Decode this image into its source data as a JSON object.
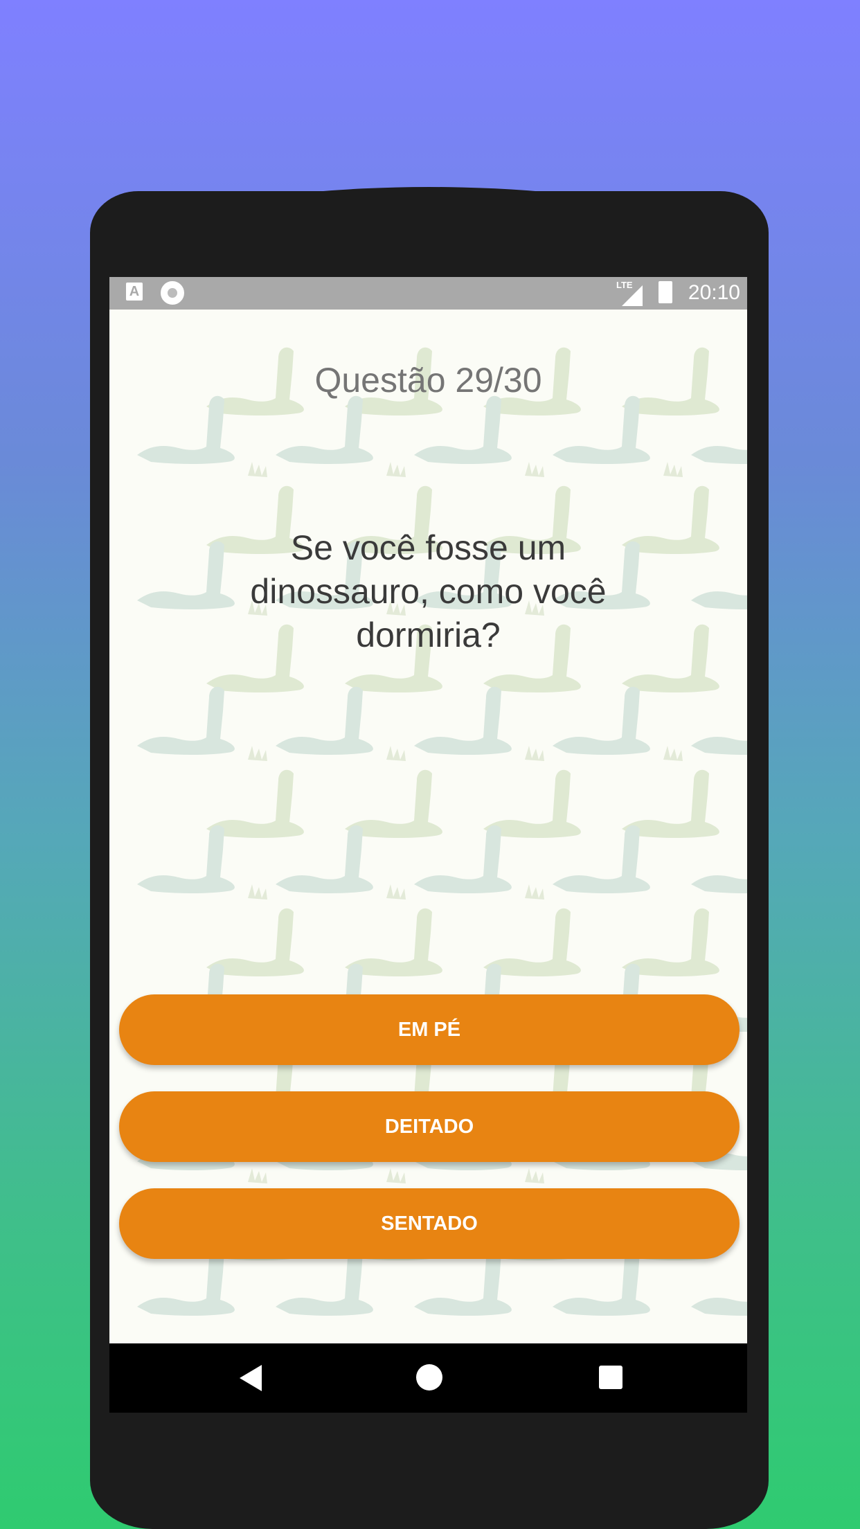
{
  "status_bar": {
    "time": "20:10",
    "network": "LTE",
    "icons": [
      "text-a-icon",
      "circle-record-icon",
      "signal-icon",
      "battery-charging-icon"
    ]
  },
  "quiz": {
    "question_number": "Questão 29/30",
    "question_text": "Se você fosse um dinossauro, como você dormiria?",
    "answers": [
      "EM PÉ",
      "DEITADO",
      "SENTADO"
    ]
  },
  "nav_bar": {
    "icons": [
      "back-icon",
      "home-icon",
      "recent-apps-icon"
    ]
  },
  "colors": {
    "answer_button": "#e88412",
    "screen_background": "#fbfcf6",
    "status_bar": "#a9a9a9",
    "gradient_top": "#7f80ff",
    "gradient_bottom": "#2fcb70"
  }
}
